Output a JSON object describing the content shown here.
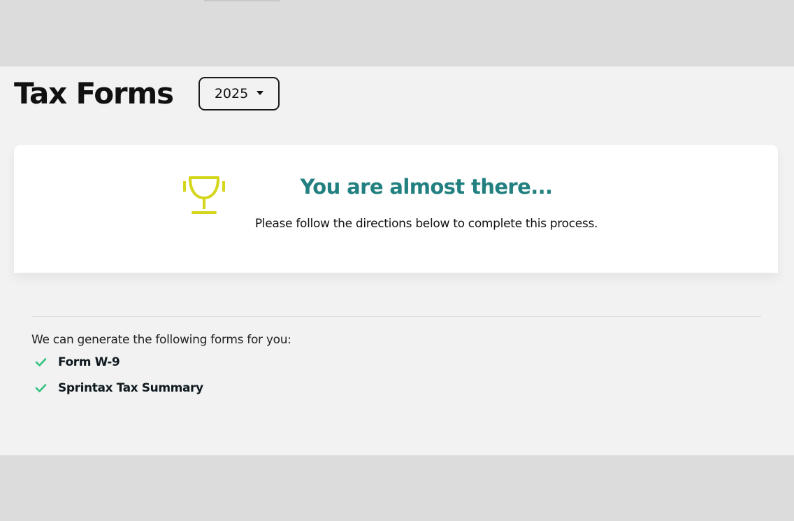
{
  "header": {
    "title": "Tax Forms",
    "year_select": {
      "selected": "2025"
    }
  },
  "notice": {
    "icon": "trophy-icon",
    "heading": "You are almost there...",
    "text": "Please follow the directions below to complete this process."
  },
  "forms": {
    "intro": "We can generate the following forms for you:",
    "items": [
      {
        "label": "Form W-9",
        "icon": "check-icon"
      },
      {
        "label": "Sprintax Tax Summary",
        "icon": "check-icon"
      }
    ]
  },
  "colors": {
    "heading_teal": "#228080",
    "trophy_yellow": "#d4d61c",
    "check_green": "#2ec27e",
    "panel_bg": "#f2f2f2",
    "outer_bg": "#dcdcdc"
  }
}
